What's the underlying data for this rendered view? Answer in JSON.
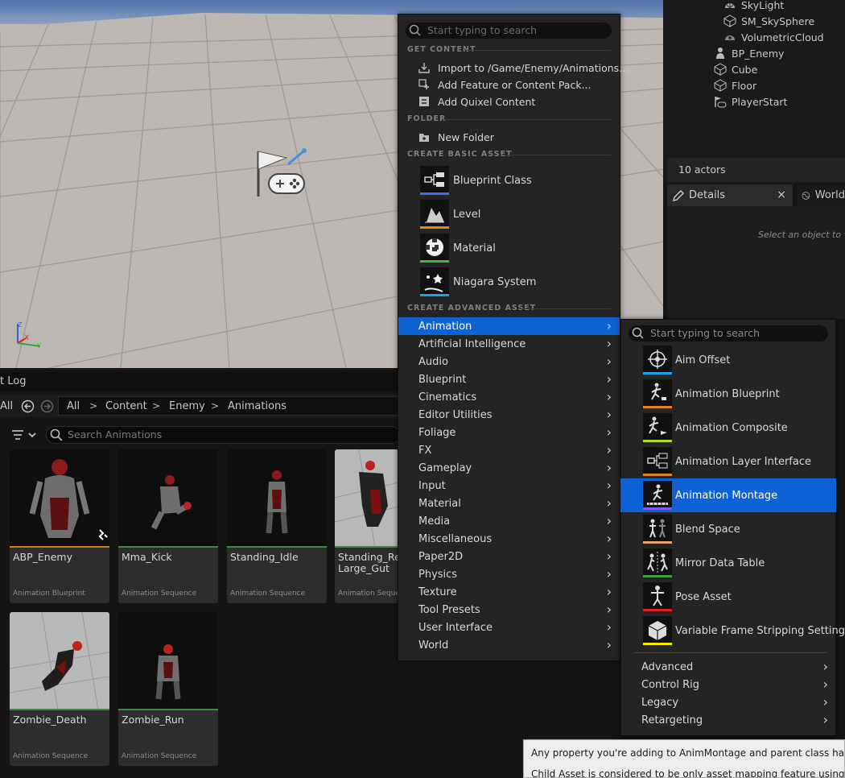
{
  "outliner": {
    "items": [
      {
        "label": "SkyLight",
        "icon": "skylight-icon"
      },
      {
        "label": "SM_SkySphere",
        "icon": "static-mesh-icon"
      },
      {
        "label": "VolumetricCloud",
        "icon": "cloud-icon"
      },
      {
        "label": "BP_Enemy",
        "icon": "pawn-icon"
      },
      {
        "label": "Cube",
        "icon": "static-mesh-icon"
      },
      {
        "label": "Floor",
        "icon": "static-mesh-icon"
      },
      {
        "label": "PlayerStart",
        "icon": "player-start-icon"
      }
    ],
    "actor_count": "10 actors"
  },
  "details": {
    "tab_label": "Details",
    "close": "×",
    "world_tab_label": "World",
    "empty_hint": "Select an object to vi"
  },
  "content_browser": {
    "log_tab": "t Log",
    "all_label": "All",
    "breadcrumb": [
      "All",
      "Content",
      "Enemy",
      "Animations"
    ],
    "search_placeholder": "Search Animations",
    "assets": [
      {
        "name": "ABP_Enemy",
        "type": "Animation Blueprint"
      },
      {
        "name": "Mma_Kick",
        "type": "Animation Sequence"
      },
      {
        "name": "Standing_Idle",
        "type": "Animation Sequence"
      },
      {
        "name": "Standing_React_Large_Gut",
        "display": "Standing_Rea\nLarge_Gut",
        "type": "Animation Sequence"
      },
      {
        "name": "Zombie_Death",
        "type": "Animation Sequence"
      },
      {
        "name": "Zombie_Run",
        "type": "Animation Sequence"
      }
    ]
  },
  "menu": {
    "search_placeholder": "Start typing to search",
    "sections": {
      "get_content": "GET CONTENT",
      "folder": "FOLDER",
      "basic": "CREATE BASIC ASSET",
      "advanced": "CREATE ADVANCED ASSET"
    },
    "get_content_items": [
      {
        "label": "Import to /Game/Enemy/Animations...",
        "icon": "import-icon"
      },
      {
        "label": "Add Feature or Content Pack...",
        "icon": "feature-pack-icon"
      },
      {
        "label": "Add Quixel Content",
        "icon": "quixel-icon"
      }
    ],
    "folder_items": [
      {
        "label": "New Folder",
        "icon": "new-folder-icon"
      }
    ],
    "basic_assets": [
      {
        "label": "Blueprint Class",
        "icon": "blueprint-class-icon",
        "color": "#3b6ee8"
      },
      {
        "label": "Level",
        "icon": "level-icon",
        "color": "#e2821c"
      },
      {
        "label": "Material",
        "icon": "material-icon",
        "color": "#3fb83f"
      },
      {
        "label": "Niagara System",
        "icon": "niagara-icon",
        "color": "#1ea3e8"
      }
    ],
    "advanced": [
      "Animation",
      "Artificial Intelligence",
      "Audio",
      "Blueprint",
      "Cinematics",
      "Editor Utilities",
      "Foliage",
      "FX",
      "Gameplay",
      "Input",
      "Material",
      "Media",
      "Miscellaneous",
      "Paper2D",
      "Physics",
      "Texture",
      "Tool Presets",
      "User Interface",
      "World"
    ],
    "selected": "Animation"
  },
  "submenu": {
    "search_placeholder": "Start typing to search",
    "items": [
      {
        "label": "Aim Offset",
        "icon": "aim-offset-icon",
        "color": "#1ea3e8"
      },
      {
        "label": "Animation Blueprint",
        "icon": "animation-blueprint-icon",
        "color": "#e2821c"
      },
      {
        "label": "Animation Composite",
        "icon": "animation-composite-icon",
        "color": "#a6e022"
      },
      {
        "label": "Animation Layer Interface",
        "icon": "animation-layer-interface-icon",
        "color": "#e2821c"
      },
      {
        "label": "Animation Montage",
        "icon": "animation-montage-icon",
        "color": "#7b5cf0"
      },
      {
        "label": "Blend Space",
        "icon": "blend-space-icon",
        "color": "#e8a070"
      },
      {
        "label": "Mirror Data Table",
        "icon": "mirror-data-table-icon",
        "color": "#3fa03f"
      },
      {
        "label": "Pose Asset",
        "icon": "pose-asset-icon",
        "color": "#e02020"
      },
      {
        "label": "Variable Frame Stripping Settings",
        "icon": "frame-stripping-icon",
        "color": "#f2e600"
      }
    ],
    "selected": "Animation Montage",
    "groups": [
      "Advanced",
      "Control Rig",
      "Legacy",
      "Retargeting"
    ]
  },
  "tooltip": {
    "line1": "Any property you're adding to AnimMontage and parent class has to be c",
    "line2": "Child Asset is considered to be only asset mapping feature using everyth"
  }
}
